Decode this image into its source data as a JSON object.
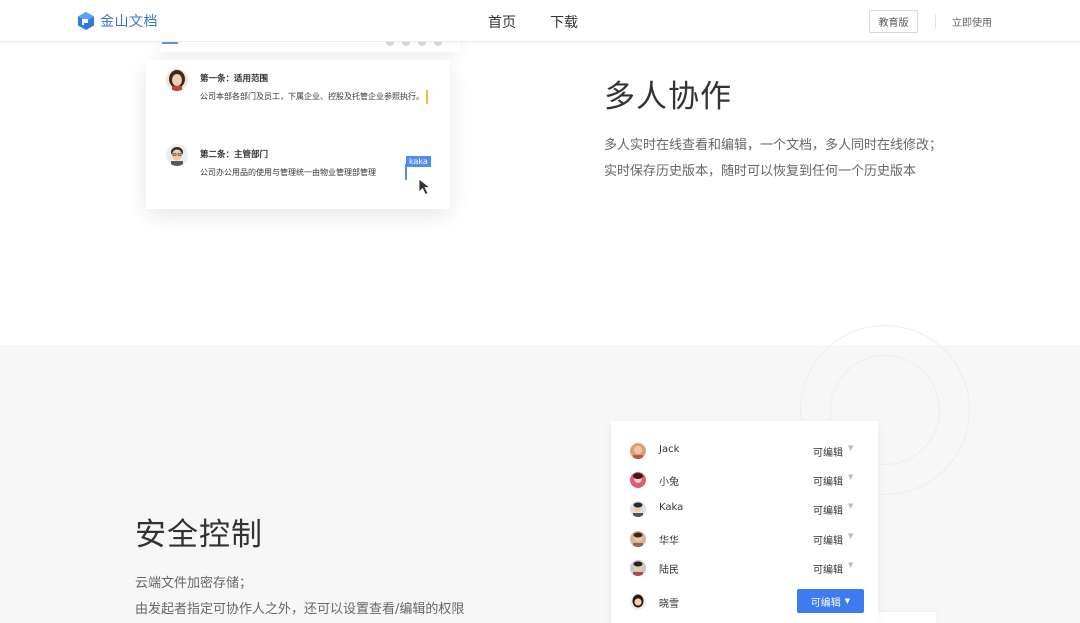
{
  "header": {
    "logo_text": "金山文档",
    "nav": [
      {
        "label": "首页"
      },
      {
        "label": "下载"
      }
    ],
    "edu_label": "教育版",
    "use_label": "立即使用",
    "brand_color": "#3d75c8"
  },
  "doc_card": {
    "clauses": [
      {
        "title": "第一条：适用范围",
        "body": "公司本部各部门及员工，下属企业、控股及托管企业参照执行。"
      },
      {
        "title": "第二条：主管部门",
        "body": "公司办公用品的使用与管理统一由物业管理部管理"
      }
    ],
    "collaborator_tag": "kaka"
  },
  "feature_collab": {
    "title": "多人协作",
    "desc_line1": "多人实时在线查看和编辑，一个文档，多人同时在线修改；",
    "desc_line2": "实时保存历史版本，随时可以恢复到任何一个历史版本"
  },
  "feature_security": {
    "title": "安全控制",
    "desc_line1": "云端文件加密存储；",
    "desc_line2": "由发起者指定可协作人之外，还可以设置查看/编辑的权限"
  },
  "permissions": {
    "accent_color": "#3d7cf0",
    "rows": [
      {
        "name": "Jack",
        "role": "可编辑",
        "active": false
      },
      {
        "name": "小兔",
        "role": "可编辑",
        "active": false
      },
      {
        "name": "Kaka",
        "role": "可编辑",
        "active": false
      },
      {
        "name": "华华",
        "role": "可编辑",
        "active": false
      },
      {
        "name": "陆民",
        "role": "可编辑",
        "active": false
      },
      {
        "name": "晓雪",
        "role": "可编辑",
        "active": true
      }
    ]
  }
}
